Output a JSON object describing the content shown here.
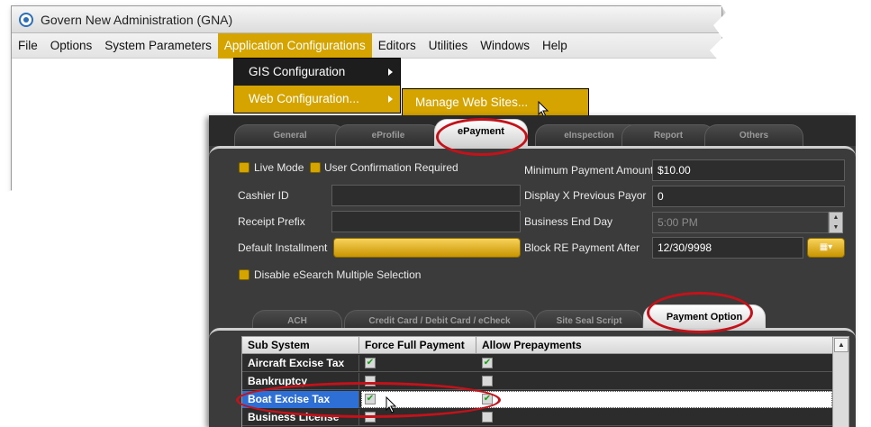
{
  "window": {
    "title": "Govern New Administration (GNA)"
  },
  "menubar": [
    "File",
    "Options",
    "System Parameters",
    "Application Configurations",
    "Editors",
    "Utilities",
    "Windows",
    "Help"
  ],
  "app_config_menu": {
    "items": [
      "GIS Configuration",
      "Web Configuration..."
    ]
  },
  "web_config_submenu": {
    "items": [
      "Manage Web Sites..."
    ]
  },
  "main_tabs": [
    "General",
    "eProfile",
    "ePayment",
    "eInspection",
    "Report",
    "Others"
  ],
  "form": {
    "live_mode": "Live Mode",
    "user_confirmation": "User Confirmation Required",
    "cashier_id": "Cashier ID",
    "receipt_prefix": "Receipt Prefix",
    "default_installment": "Default Installment",
    "disable_esearch": "Disable eSearch Multiple Selection",
    "min_payment_label": "Minimum Payment Amount",
    "min_payment_value": "$10.00",
    "display_prev_label": "Display X Previous Payor",
    "display_prev_value": "0",
    "business_end_label": "Business End Day",
    "business_end_value": "5:00 PM",
    "block_re_label": "Block RE Payment After",
    "block_re_value": "12/30/9998"
  },
  "sub_tabs": [
    "ACH",
    "Credit Card / Debit Card / eCheck",
    "Site Seal Script",
    "Payment Option"
  ],
  "grid": {
    "headers": [
      "Sub System",
      "Force Full Payment",
      "Allow Prepayments"
    ],
    "rows": [
      {
        "name": "Aircraft Excise Tax",
        "force_full": true,
        "allow_prepay": true
      },
      {
        "name": "Bankruptcy",
        "force_full": false,
        "allow_prepay": false
      },
      {
        "name": "Boat Excise Tax",
        "force_full": true,
        "allow_prepay": true
      },
      {
        "name": "Business License",
        "force_full": false,
        "allow_prepay": false
      }
    ],
    "check_glyph": "✔"
  },
  "colors": {
    "accent": "#d6a400",
    "highlight_oval": "#c4121a",
    "selected_row": "#2e6fd6"
  }
}
